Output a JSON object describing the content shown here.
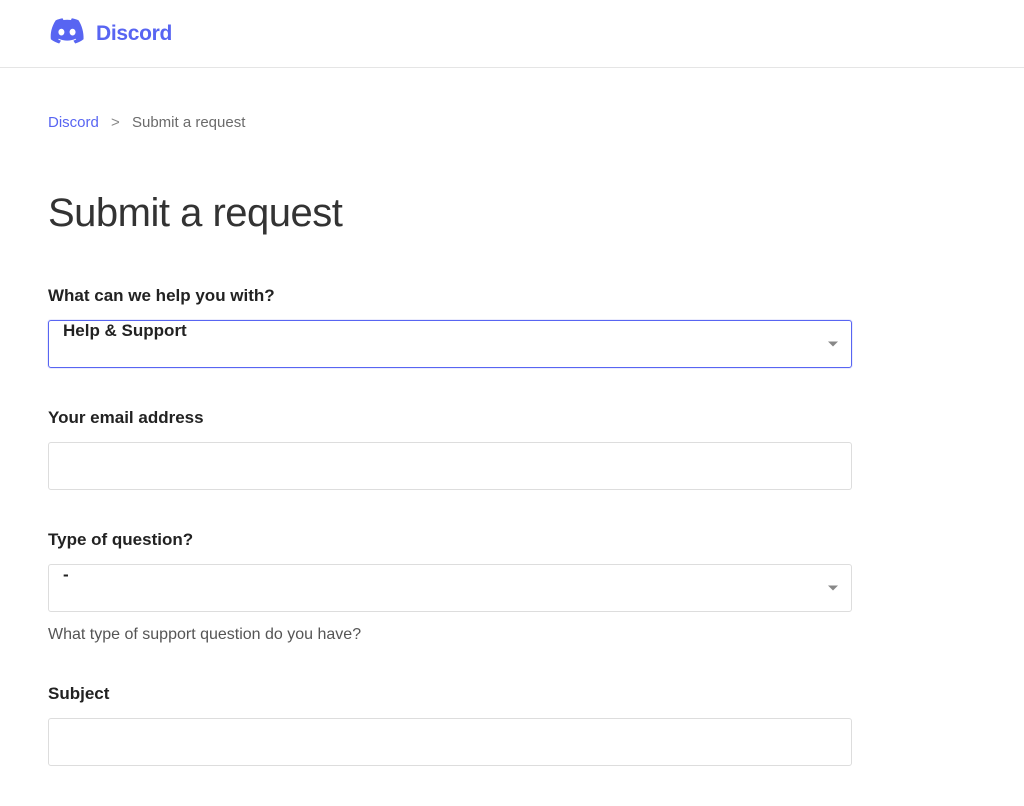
{
  "header": {
    "brand": "Discord"
  },
  "breadcrumb": {
    "home": "Discord",
    "current": "Submit a request"
  },
  "page": {
    "title": "Submit a request"
  },
  "form": {
    "help_with": {
      "label": "What can we help you with?",
      "value": "Help & Support"
    },
    "email": {
      "label": "Your email address",
      "value": ""
    },
    "question_type": {
      "label": "Type of question?",
      "value": "-",
      "hint": "What type of support question do you have?"
    },
    "subject": {
      "label": "Subject",
      "value": ""
    }
  }
}
